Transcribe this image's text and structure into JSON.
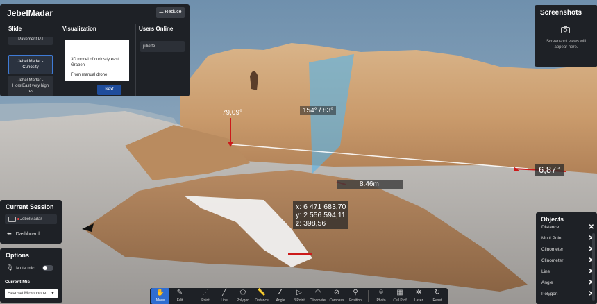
{
  "app": {
    "title": "JebelMadar"
  },
  "slide_panel": {
    "reduce_label": "Reduce",
    "slide_header": "Slide",
    "visualization_header": "Visualization",
    "users_header": "Users Online",
    "slides": [
      "Pavement PJ",
      "Jebel Madar - Curiosity",
      "Jebel Madar - HorstEast very high res"
    ],
    "active_slide": "Jebel Madar - Curiosity",
    "visualization_text_1": "3D model of curiosity east Graben",
    "visualization_text_2": "From manual drone",
    "next_label": "Next",
    "users": [
      "juliette"
    ]
  },
  "screenshots": {
    "title": "Screenshots",
    "hint": "Screenshot views will appear here."
  },
  "session": {
    "title": "Current Session",
    "session_name": "JebelMadar",
    "dashboard_label": "Dashboard"
  },
  "options": {
    "title": "Options",
    "mute_label": "Mute mic",
    "mute_on": false,
    "current_mic_label": "Current Mic",
    "mic_value": "Headset Microphone..."
  },
  "objects": {
    "title": "Objects",
    "items": [
      "Distance",
      "Multi Point...",
      "Clinometer",
      "Clinometer",
      "Line",
      "Angle",
      "Polygon"
    ]
  },
  "toolbar": {
    "tools": [
      {
        "label": "Move",
        "icon": "hand-icon",
        "active": true
      },
      {
        "label": "Edit",
        "icon": "pencil-icon"
      },
      {
        "label": "Point",
        "icon": "point-icon"
      },
      {
        "label": "Line",
        "icon": "line-icon"
      },
      {
        "label": "Polygon",
        "icon": "polygon-icon"
      },
      {
        "label": "Distance",
        "icon": "ruler-icon"
      },
      {
        "label": "Angle",
        "icon": "angle-icon"
      },
      {
        "label": "3 Point",
        "icon": "three-point-icon"
      },
      {
        "label": "Clinometer",
        "icon": "clinometer-icon"
      },
      {
        "label": "Compass",
        "icon": "compass-icon"
      },
      {
        "label": "Position",
        "icon": "pin-icon"
      },
      {
        "label": "Photo",
        "icon": "camera-icon"
      },
      {
        "label": "Cell Prof",
        "icon": "cell-profile-icon"
      },
      {
        "label": "Laser",
        "icon": "laser-icon"
      },
      {
        "label": "Reset",
        "icon": "reset-icon"
      }
    ]
  },
  "measurements": {
    "clinometer_1": "79,09°",
    "plane_orientation": "154° / 83°",
    "clinometer_2": "6,87°",
    "distance": "8.46m",
    "coord_x": "x: 6 471 683,70",
    "coord_y": "y: 2 556 594,11",
    "coord_z": "z: 398,56"
  },
  "colors": {
    "panel_bg": "#1e2126",
    "accent": "#2f6dd0",
    "plane": "#5ab4e6",
    "marker": "#cc1a1a"
  }
}
